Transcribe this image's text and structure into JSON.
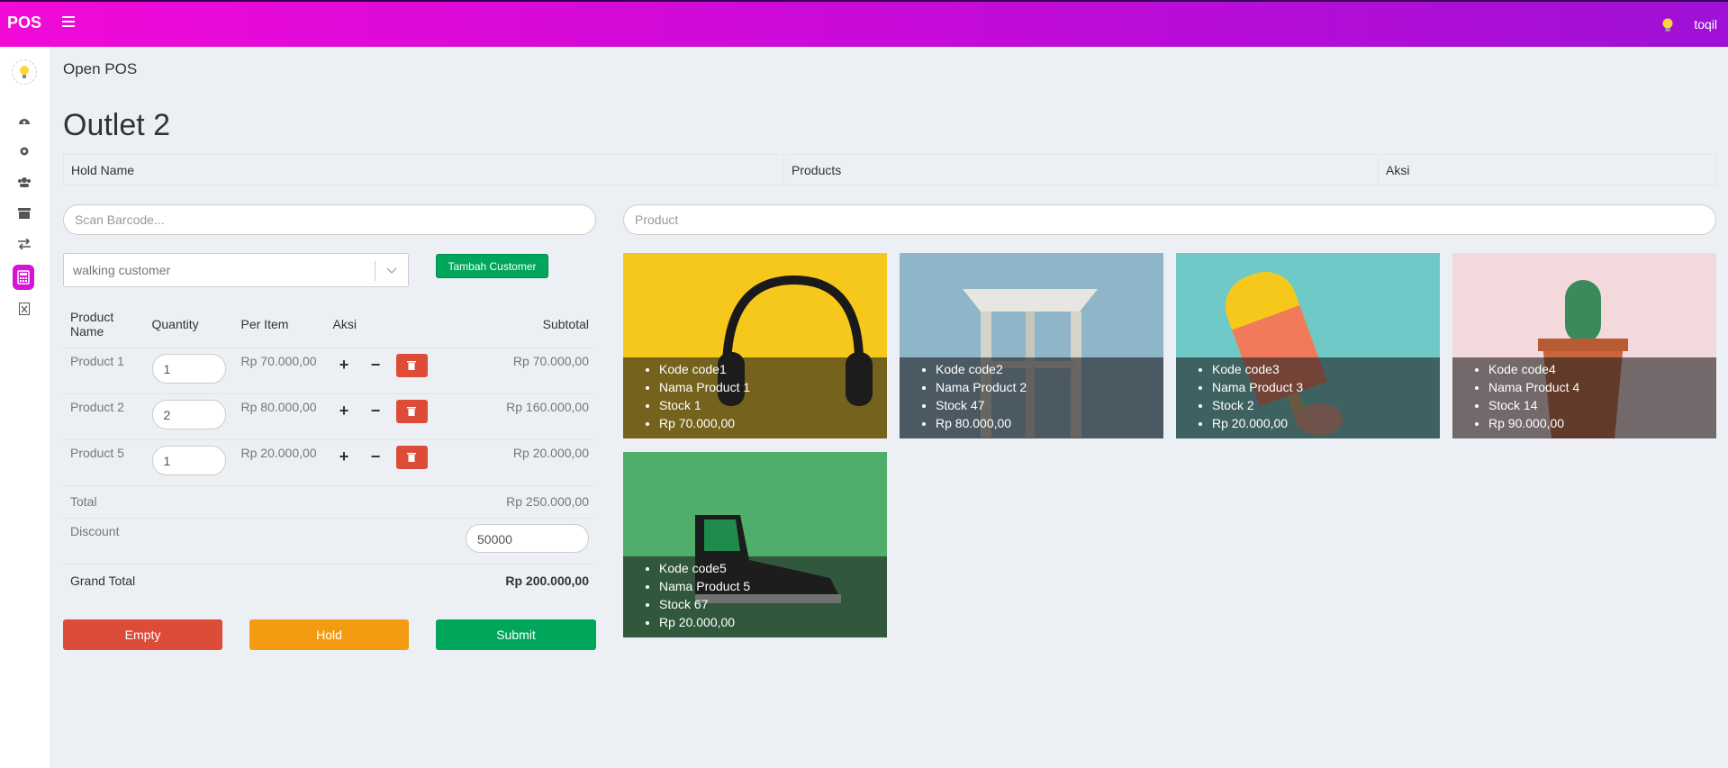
{
  "topbar": {
    "brand": "POS",
    "user_name": "toqil"
  },
  "breadcrumb": "Open POS",
  "outlet_title": "Outlet 2",
  "hold_table": {
    "col_hold_name": "Hold Name",
    "col_products": "Products",
    "col_aksi": "Aksi"
  },
  "scan": {
    "placeholder": "Scan Barcode..."
  },
  "product_search": {
    "placeholder": "Product"
  },
  "customer": {
    "selected": "walking customer",
    "add_label": "Tambah Customer"
  },
  "cart": {
    "headers": {
      "product_name": "Product Name",
      "quantity": "Quantity",
      "per_item": "Per Item",
      "aksi": "Aksi",
      "subtotal": "Subtotal"
    },
    "rows": [
      {
        "name": "Product 1",
        "qty": "1",
        "price": "Rp 70.000,00",
        "subtotal": "Rp 70.000,00"
      },
      {
        "name": "Product 2",
        "qty": "2",
        "price": "Rp 80.000,00",
        "subtotal": "Rp 160.000,00"
      },
      {
        "name": "Product 5",
        "qty": "1",
        "price": "Rp 20.000,00",
        "subtotal": "Rp 20.000,00"
      }
    ],
    "total_label": "Total",
    "total_value": "Rp 250.000,00",
    "discount_label": "Discount",
    "discount_value": "50000",
    "grand_total_label": "Grand Total",
    "grand_total_value": "Rp 200.000,00"
  },
  "actions": {
    "empty": "Empty",
    "hold": "Hold",
    "submit": "Submit"
  },
  "products": [
    {
      "code": "Kode code1",
      "name": "Nama Product 1",
      "stock": "Stock 1",
      "price": "Rp 70.000,00",
      "bg": "#f6c81c",
      "image": "headphones"
    },
    {
      "code": "Kode code2",
      "name": "Nama Product 2",
      "stock": "Stock 47",
      "price": "Rp 80.000,00",
      "bg": "#8fb5c9",
      "image": "stool"
    },
    {
      "code": "Kode code3",
      "name": "Nama Product 3",
      "stock": "Stock 2",
      "price": "Rp 20.000,00",
      "bg": "#6fc9c7",
      "image": "popsicle"
    },
    {
      "code": "Kode code4",
      "name": "Nama Product 4",
      "stock": "Stock 14",
      "price": "Rp 90.000,00",
      "bg": "#f3d9dc",
      "image": "cactus"
    },
    {
      "code": "Kode code5",
      "name": "Nama Product 5",
      "stock": "Stock 67",
      "price": "Rp 20.000,00",
      "bg": "#4fae6a",
      "image": "sneaker"
    }
  ],
  "icons": [
    "menu-icon",
    "bulb-icon",
    "dashboard-icon",
    "gear-icon",
    "users-icon",
    "archive-icon",
    "exchange-icon",
    "calculator-icon",
    "excel-icon",
    "chevron-down-icon",
    "plus-icon",
    "minus-icon",
    "trash-icon"
  ]
}
